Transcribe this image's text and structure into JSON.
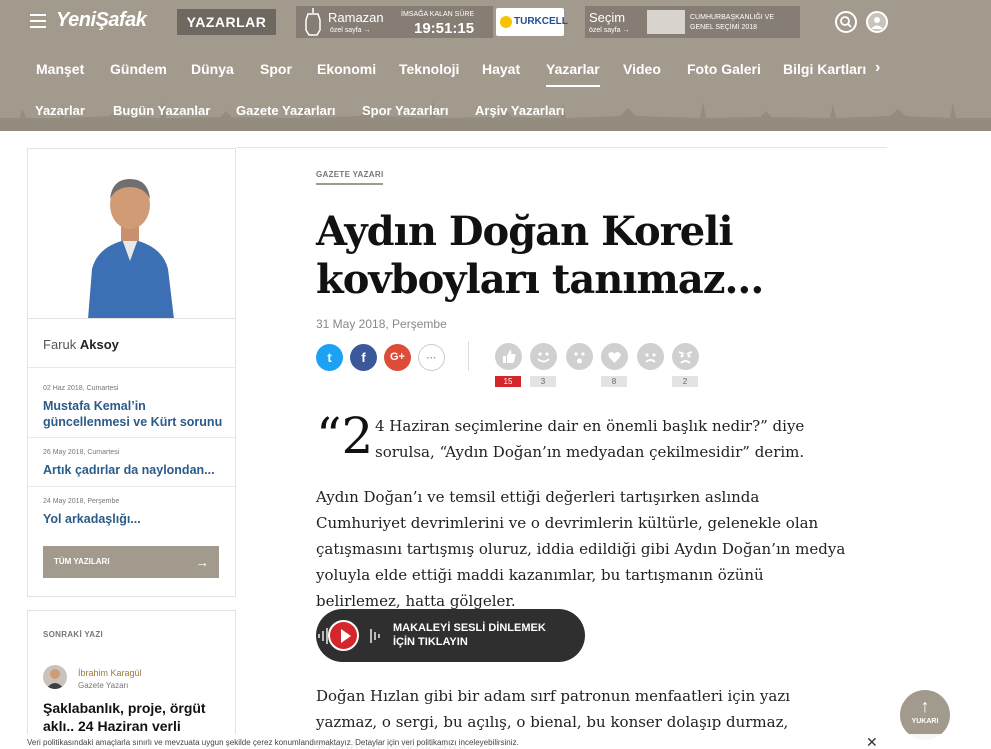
{
  "header": {
    "logo": "YeniŞafak",
    "section": "YAZARLAR",
    "ramazan": {
      "title": "Ramazan",
      "sub": "özel sayfa →",
      "imsak_label": "İMSAĞA KALAN SÜRE",
      "imsak_time": "19:51:15"
    },
    "sponsor": "TURKCELL",
    "secim": {
      "title": "Seçim",
      "sub": "özel sayfa →",
      "desc": "CUMHURBAŞKANLIĞI VE GENEL SEÇİMİ 2018"
    },
    "nav": [
      "Manşet",
      "Gündem",
      "Dünya",
      "Spor",
      "Ekonomi",
      "Teknoloji",
      "Hayat",
      "Yazarlar",
      "Video",
      "Foto Galeri",
      "Bilgi Kartları"
    ],
    "nav_active": "Yazarlar",
    "subnav": [
      "Yazarlar",
      "Bugün Yazanlar",
      "Gazete Yazarları",
      "Spor Yazarları",
      "Arşiv Yazarları"
    ]
  },
  "sidebar": {
    "author_first": "Faruk",
    "author_last": "Aksoy",
    "items": [
      {
        "date": "02 Haz 2018, Cumartesi",
        "title": "Mustafa Kemal’in güncellenmesi ve Kürt sorunu"
      },
      {
        "date": "26 May 2018, Cumartesi",
        "title": "Artık çadırlar da naylondan..."
      },
      {
        "date": "24 May 2018, Perşembe",
        "title": "Yol arkadaşlığı..."
      }
    ],
    "all_button": "TÜM YAZILARI",
    "next": {
      "label": "SONRAKİ YAZI",
      "author": "İbrahim Karagül",
      "role": "Gazete Yazarı",
      "title": "Şaklabanlık, proje, örgüt aklı.. 24 Haziran verli"
    }
  },
  "article": {
    "kicker": "GAZETE YAZARI",
    "title": "Aydın Doğan Koreli kovboyları tanımaz...",
    "date": "31 May 2018, Perşembe",
    "share": [
      "t",
      "f",
      "G+",
      "···"
    ],
    "reactions": [
      "15",
      "3",
      "",
      "8",
      "",
      "2"
    ],
    "lead_drop": "“2",
    "lead": "4 Haziran seçimlerine dair en önemli başlık nedir?” diye sorulsa, “Aydın Doğan’ın medyadan çekilmesidir” derim.",
    "p1": "Aydın Doğan’ı ve temsil ettiği değerleri tartışırken aslında Cumhuriyet devrimlerini ve o devrimlerin kültürle, gelenekle olan çatışmasını tartışmış oluruz, iddia edildiği gibi Aydın Doğan’ın medya yoluyla elde ettiği maddi kazanımlar, bu tartışmanın özünü belirlemez, hatta gölgeler.",
    "audio": "MAKALEYİ SESLİ DİNLEMEK İÇİN TIKLAYIN",
    "p2": "Doğan Hızlan gibi bir adam sırf patronun menfaatleri için yazı yazmaz, o sergi, bu açılış, o bienal, bu konser dolaşıp durmaz, Ertuğrul Özkök gibi"
  },
  "up_label": "YUKARI",
  "cookie": "Veri politikasındaki amaçlarla sınırlı ve mevzuata uygun şekilde çerez konumlandırmaktayız. Detaylar için veri politikamızı inceleyebilirsiniz."
}
